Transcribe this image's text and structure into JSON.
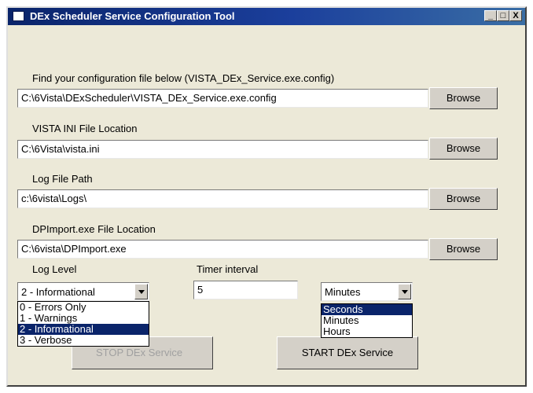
{
  "window": {
    "title": "DEx Scheduler Service Configuration Tool",
    "minimize": "_",
    "maximize": "□",
    "close": "X"
  },
  "config_file": {
    "label": "Find your configuration file below (VISTA_DEx_Service.exe.config)",
    "value": "C:\\6Vista\\DExScheduler\\VISTA_DEx_Service.exe.config",
    "browse": "Browse"
  },
  "ini_file": {
    "label": "VISTA INI File Location",
    "value": "C:\\6Vista\\vista.ini",
    "browse": "Browse"
  },
  "log_path": {
    "label": "Log File Path",
    "value": "c:\\6vista\\Logs\\",
    "browse": "Browse"
  },
  "dpimport": {
    "label": "DPImport.exe File Location",
    "value": "C:\\6vista\\DPImport.exe",
    "browse": "Browse"
  },
  "log_level": {
    "label": "Log Level",
    "selected": "2 - Informational",
    "options": [
      "0 - Errors Only",
      "1 - Warnings",
      "2 - Informational",
      "3 - Verbose"
    ]
  },
  "timer": {
    "label": "Timer interval",
    "value": "5"
  },
  "unit": {
    "selected": "Minutes",
    "options": [
      "Seconds",
      "Minutes",
      "Hours"
    ]
  },
  "buttons": {
    "stop": "STOP DEx Service",
    "start": "START DEx Service"
  }
}
